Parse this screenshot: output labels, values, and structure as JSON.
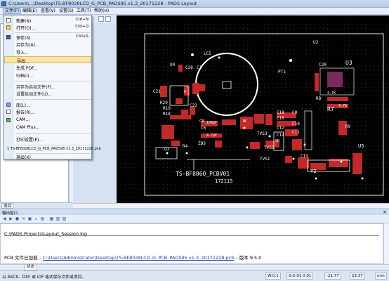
{
  "titlebar": {
    "title": "C:\\Users\\...\\Desktop\\TS-BF8028LCD_G_PCB_PADS95 v1.3_20171228 - PADS Layout"
  },
  "menubar": {
    "items": [
      "文件(F)",
      "编辑(E)",
      "查看(V)",
      "设置(S)",
      "工具(T)",
      "帮助(H)"
    ]
  },
  "file_menu": {
    "items": [
      {
        "label": "新建(N)",
        "shortcut": "Ctrl+N"
      },
      {
        "label": "打开(O)...",
        "shortcut": "Ctrl+O"
      },
      {
        "label": "保存(S)",
        "shortcut": "Ctrl+S"
      },
      {
        "label": "另存为(A)...",
        "shortcut": ""
      },
      {
        "label": "导入...",
        "shortcut": ""
      },
      {
        "label": "导出...",
        "shortcut": ""
      },
      {
        "label": "生成 PDF...",
        "shortcut": ""
      },
      {
        "label": "归档(I)...",
        "shortcut": ""
      },
      {
        "label": "另存为启动文件(F)...",
        "shortcut": ""
      },
      {
        "label": "设置启动文件(U)...",
        "shortcut": ""
      },
      {
        "label": "库(L)...",
        "shortcut": ""
      },
      {
        "label": "报告(R)...",
        "shortcut": ""
      },
      {
        "label": "CAM...",
        "shortcut": ""
      },
      {
        "label": "CAM Plus...",
        "shortcut": ""
      },
      {
        "label": "打印设置(P)...",
        "shortcut": ""
      },
      {
        "label": "1 TS-BF8028LCD_G_PCB_PADS95 v1.3_20171228.pcb",
        "shortcut": ""
      },
      {
        "label": "退出(X)",
        "shortcut": ""
      }
    ]
  },
  "left_panel": {
    "tab": "项目"
  },
  "pcb": {
    "labels": [
      "LC5",
      "U4",
      "U2",
      "PT1",
      "U3",
      "C20",
      "R7",
      "C26",
      "C1",
      "C21",
      "C22",
      "R20",
      "R19",
      "R18",
      "C8",
      "C6",
      "C18",
      "C16",
      "C12",
      "C14",
      "C9",
      "C10",
      "C11",
      "R8",
      "R9",
      "U5",
      "C13",
      "Y2",
      "Q1",
      "R4",
      "ZD3",
      "TVS3",
      "TVS2",
      "TVS1",
      "TS-BF8060_PCBV01",
      "172115"
    ],
    "values": [
      "4.7K",
      "100pF",
      "4.7pF",
      "NC",
      "0",
      "0R",
      "4.7K"
    ]
  },
  "output_panel": {
    "title": "输出窗口",
    "session_path": "C:\\PADS Projects\\Layout_Session.log",
    "loaded_prefix": "PCB 文件已加载  –",
    "loaded_file": "C:\\Users\\Administrator\\Desktop\\TS-BF8028LCD_G_PCB_PADS95 v1.3_20171228.pcb",
    "loaded_suffix": "– 版本  9.5.0",
    "tabs": [
      "状态"
    ]
  },
  "statusbar": {
    "message": "以 ASCII、DXF 或 IDF 格式保存文件或项目。",
    "w_field": "W:0.1",
    "g_field": "G:0.01 0.01",
    "x_field": "-21.77",
    "y_field": "23.37",
    "unit": "mm"
  }
}
